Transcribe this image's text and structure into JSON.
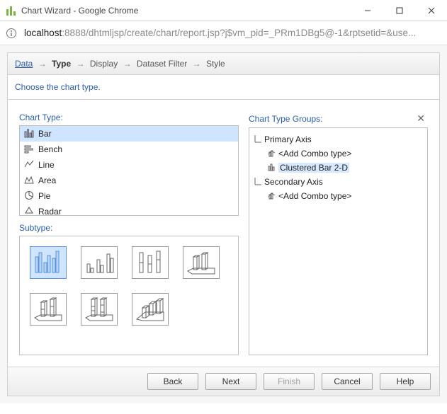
{
  "window": {
    "title": "Chart Wizard - Google Chrome"
  },
  "url": {
    "host": "localhost",
    "path": ":8888/dhtmljsp/create/chart/report.jsp?j$vm_pid=_PRm1DBg5@-1&rptsetid=&use..."
  },
  "breadcrumb": {
    "data": "Data",
    "type": "Type",
    "display": "Display",
    "dataset_filter": "Dataset Filter",
    "style": "Style",
    "arrow": "→"
  },
  "prompt": "Choose the chart type.",
  "left": {
    "chart_type_label": "Chart Type:",
    "types": {
      "bar": "Bar",
      "bench": "Bench",
      "line": "Line",
      "area": "Area",
      "pie": "Pie",
      "radar": "Radar"
    },
    "subtype_label": "Subtype:"
  },
  "right": {
    "groups_label": "Chart Type Groups:",
    "primary_axis": "Primary Axis",
    "add_combo_1": "<Add Combo type>",
    "clustered": "Clustered Bar 2-D",
    "secondary_axis": "Secondary Axis",
    "add_combo_2": "<Add Combo type>"
  },
  "buttons": {
    "back": "Back",
    "next": "Next",
    "finish": "Finish",
    "cancel": "Cancel",
    "help": "Help"
  }
}
